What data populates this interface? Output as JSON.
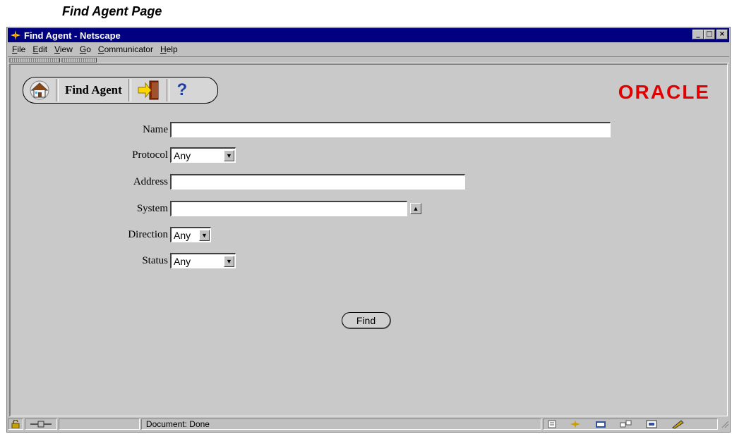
{
  "caption": "Find Agent Page",
  "window": {
    "title": "Find Agent - Netscape",
    "controls": [
      "minimize",
      "maximize",
      "close"
    ]
  },
  "menu": [
    "File",
    "Edit",
    "View",
    "Go",
    "Communicator",
    "Help"
  ],
  "toolbar": {
    "title": "Find Agent",
    "help_glyph": "?"
  },
  "brand": {
    "logo_text": "ORACLE",
    "color": "#e30000"
  },
  "form": {
    "name_label": "Name",
    "name_value": "",
    "protocol_label": "Protocol",
    "protocol_value": "Any",
    "address_label": "Address",
    "address_value": "",
    "system_label": "System",
    "system_value": "",
    "direction_label": "Direction",
    "direction_value": "Any",
    "status_label": "Status",
    "status_value": "Any",
    "find_button": "Find"
  },
  "statusbar": {
    "text": "Document: Done"
  },
  "colors": {
    "titlebar": "#000080",
    "window_bg": "#c0c0c0",
    "content_bg": "#c9c9c9"
  }
}
